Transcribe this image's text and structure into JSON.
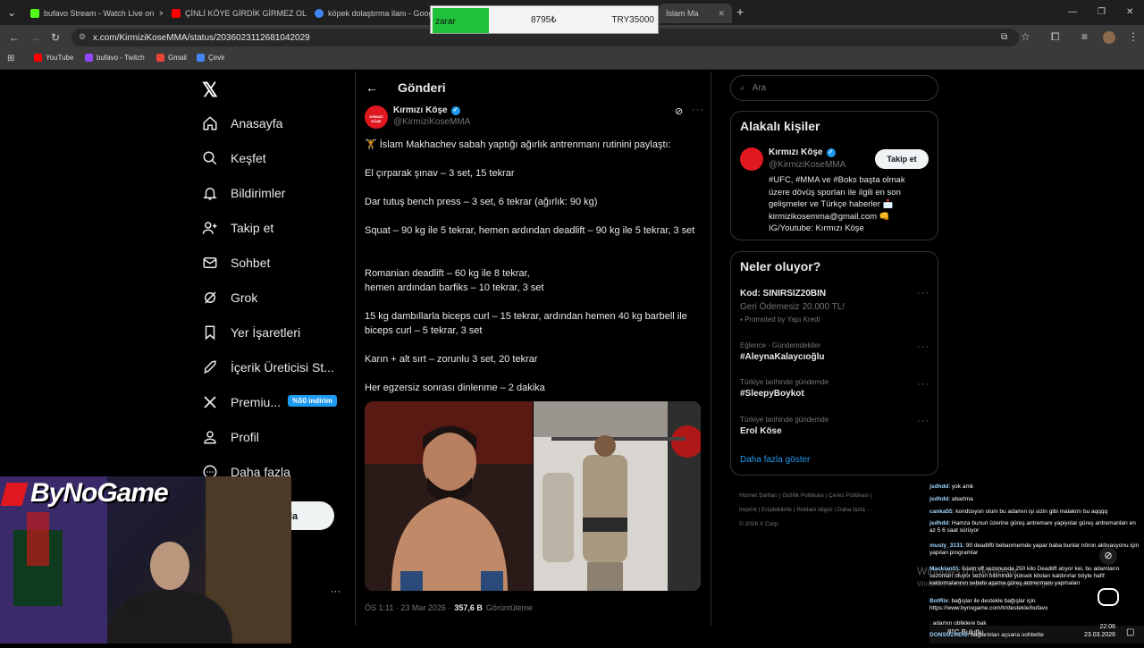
{
  "browser": {
    "tabs": [
      {
        "title": "bufavo Stream - Watch Live on",
        "color": "#53fc18"
      },
      {
        "title": "ÇİNLİ KÖYE GİRDİK GİRMEZ OL",
        "color": "#ff0000"
      },
      {
        "title": "köpek dolaştırma ilanı - Google",
        "color": "#4285f4"
      },
      {
        "title": "İslam Ma",
        "color": "#000000"
      }
    ],
    "url": "x.com/KirmiziKoseMMA/status/2036023112681042029",
    "bookmarks": [
      "YouTube",
      "bufavo - Twitch",
      "Gmail",
      "Çevir"
    ]
  },
  "overlay": {
    "label": "zarar",
    "value": "8795₺",
    "target": "TRY35000"
  },
  "nav": {
    "items": [
      "Anasayfa",
      "Keşfet",
      "Bildirimler",
      "Takip et",
      "Sohbet",
      "Grok",
      "Yer İşaretleri",
      "İçerik Üreticisi St...",
      "Premiu...",
      "Profil",
      "Daha fazla"
    ],
    "premium_badge": "%50 indirim",
    "post_button_partial": "la"
  },
  "post": {
    "header": "Gönderi",
    "author_name": "Kırmızı Köşe",
    "author_handle": "@KirmiziKoseMMA",
    "avatar_text": "KIRMIZI KÖŞE",
    "paragraphs": [
      "🏋️ İslam Makhachev sabah yaptığı ağırlık antrenmanı rutinini paylaştı:",
      "El çırparak şınav – 3 set, 15 tekrar",
      "Dar tutuş bench press – 3 set, 6 tekrar (ağırlık: 90 kg)",
      "Squat – 90 kg ile 5 tekrar, hemen ardından deadlift – 90 kg ile 5 tekrar, 3 set",
      "Romanian deadlift – 60 kg ile 8 tekrar,\nhemen ardından barfiks – 10 tekrar, 3 set",
      "15 kg dambıllarla biceps curl – 15 tekrar, ardından hemen 40 kg barbell ile biceps curl – 5 tekrar, 3 set",
      "Karın + alt sırt – zorunlu 3 set, 20 tekrar",
      "Her egzersiz sonrası dinlenme – 2 dakika"
    ],
    "time": "ÖS 1:11 · 23 Mar 2026 ·",
    "views_count": "357,6 B",
    "views_label": "Görüntüleme"
  },
  "right": {
    "search_placeholder": "Ara",
    "related_title": "Alakalı kişiler",
    "related_name": "Kırmızı Köşe",
    "related_handle": "@KirmiziKoseMMA",
    "follow_label": "Takip et",
    "bio_1": "#UFC, #MMA ve #Boks başta olmak",
    "bio_2": "üzere dövüş sporları ile ilgili en son",
    "bio_3": "gelişmeler ve Türkçe haberler 📩",
    "bio_4": "kirmizikosemma@gmail.com 👊",
    "bio_5": "IG/Youtube: Kırmızı Köşe",
    "trends_title": "Neler oluyor?",
    "promo_title": "Kod: SINIRSIZ20BIN",
    "promo_sub": "Geri Ödemesiz 20.000 TL!",
    "promo_by": "Promoted by Yapı Kredi",
    "trends": [
      {
        "context": "Eğlence · Gündemdekiler",
        "name": "#AleynaKalaycıoğlu"
      },
      {
        "context": "Türkiye tarihinde gündemde",
        "name": "#SleepyBoykot"
      },
      {
        "context": "Türkiye tarihinde gündemde",
        "name": "Erol Köse"
      }
    ],
    "show_more": "Daha fazla göster",
    "footer_1": "Hizmet Şartları  |  Gizlilik Politikası  |  Çerez Politikası  |",
    "footer_2": "Imprint  |  Erişilebilirlik  |  Reklam bilgisi  |  Daha fazla ···",
    "footer_3": "© 2026 X Corp."
  },
  "stream": {
    "logo": "ByNoGame",
    "chat": [
      {
        "user": "jsdhdd",
        "msg": ": yok amk"
      },
      {
        "user": "jsdhdd",
        "msg": ": abartma"
      },
      {
        "user": "canka55",
        "msg": ": kondüsyon olum bu adamın işi sizin gibi malakmı bu aqqqq"
      },
      {
        "user": "jsdhdd",
        "msg": ": Hamza bunun üzerine güreş antremanı yapiyolar güreş antremanları en az 5 6 saat sürüyor"
      },
      {
        "user": "musty_3131",
        "msg": ": 90 deadlifti bebanmemde yapar baba bunlar nöron aktivasyonu için yapılan programlar"
      },
      {
        "user": "Macklan01",
        "msg": ": İslam off sezonunda 250 kilo Deadlift atıyor kei, bu adamların sezonları oluyor sezon bitiminde yüksek kiloları kaldırırlar böyle hafif kaldırmalarının sebebi aşama güreş antrenmanı yapmaları"
      },
      {
        "user": "BotRix",
        "msg": ": bağışlar ile destekle bağışlar için https://www.bynogame.com/tr/destekle/bufavo"
      },
      {
        "user": "",
        "msg": ": adamın obliklere bak"
      },
      {
        "user": "DONSUZREIS",
        "msg": ": bağlantıları açsana sohbette"
      }
    ],
    "watermark_1": "Windows'u Etkinleştir",
    "watermark_2": "Windows'u etkinleştirmek için Ayarlar'a gidin."
  },
  "taskbar": {
    "weather": "8°C  Bulutlu",
    "time": "22:06",
    "date": "23.03.2026"
  }
}
